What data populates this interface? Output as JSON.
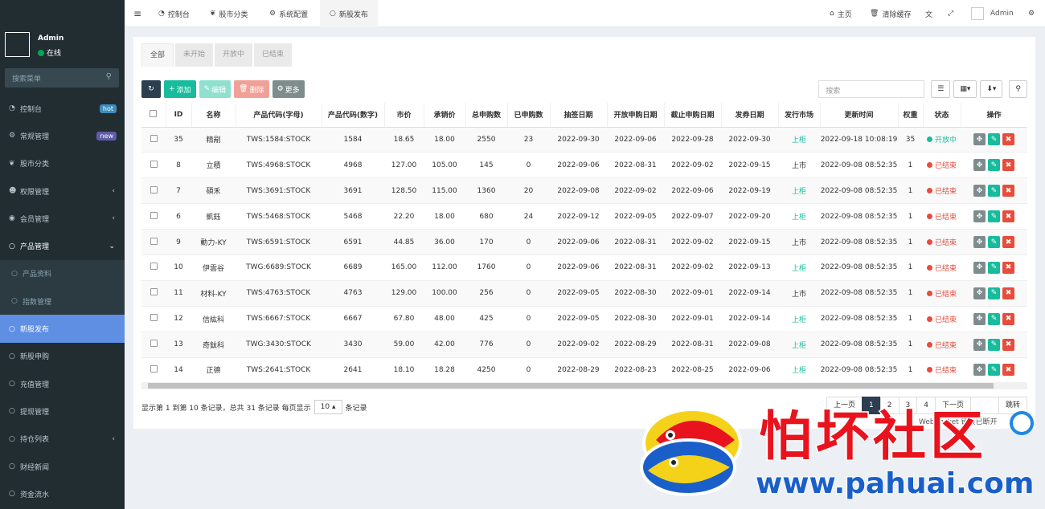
{
  "user": {
    "name": "Admin",
    "status": "在线"
  },
  "sidebar": {
    "search_placeholder": "搜索菜单",
    "items": [
      {
        "label": "控制台",
        "badge": "hot",
        "icon": "dashboard-icon"
      },
      {
        "label": "常规管理",
        "badge": "new",
        "icon": "cogs-icon"
      },
      {
        "label": "股市分类",
        "icon": "leaf-icon"
      },
      {
        "label": "权限管理",
        "icon": "group-icon",
        "caret": "‹"
      },
      {
        "label": "会员管理",
        "icon": "user-circle-icon",
        "caret": "‹"
      },
      {
        "label": "产品管理",
        "icon": "circle-icon",
        "caret": "⌄"
      },
      {
        "label": "产品资料",
        "icon": "circle-icon",
        "sub": true
      },
      {
        "label": "指数管理",
        "icon": "circle-icon",
        "sub": true
      },
      {
        "label": "新股发布",
        "icon": "circle-icon",
        "active": true
      },
      {
        "label": "新股申购",
        "icon": "circle-icon"
      },
      {
        "label": "充值管理",
        "icon": "circle-icon"
      },
      {
        "label": "提现管理",
        "icon": "circle-icon"
      },
      {
        "label": "持仓列表",
        "icon": "circle-icon",
        "caret": "‹"
      },
      {
        "label": "财经新闻",
        "icon": "circle-icon"
      },
      {
        "label": "资金流水",
        "icon": "circle-icon"
      }
    ]
  },
  "topbar": {
    "tabs": [
      "控制台",
      "股市分类",
      "系统配置",
      "新股发布"
    ],
    "home": "主页",
    "clear_cache": "清除缓存",
    "admin": "Admin"
  },
  "content": {
    "tabs": [
      "全部",
      "未开始",
      "开放中",
      "已结束"
    ],
    "buttons": {
      "add": "添加",
      "edit": "编辑",
      "delete": "删除",
      "more": "更多"
    },
    "search_placeholder": "搜索",
    "columns": [
      "ID",
      "名称",
      "产品代码(字母)",
      "产品代码(数字)",
      "市价",
      "承销价",
      "总申购数",
      "已申购数",
      "抽签日期",
      "开放申购日期",
      "截止申购日期",
      "发券日期",
      "发行市场",
      "更新时间",
      "权重",
      "状态",
      "操作"
    ],
    "rows": [
      {
        "id": "35",
        "name": "精剐",
        "code_alpha": "TWS:1584:STOCK",
        "code_num": "1584",
        "price": "18.65",
        "underwrite": "18.00",
        "total": "2550",
        "applied": "23",
        "draw": "2022-09-30",
        "open": "2022-09-06",
        "close": "2022-09-28",
        "issue": "2022-09-30",
        "market": "上柜",
        "updated": "2022-09-18 10:08:19",
        "weight": "35",
        "status": "开放中",
        "status_color": "#18bc9c",
        "market_color": "#18bc9c"
      },
      {
        "id": "8",
        "name": "立積",
        "code_alpha": "TWS:4968:STOCK",
        "code_num": "4968",
        "price": "127.00",
        "underwrite": "105.00",
        "total": "145",
        "applied": "0",
        "draw": "2022-09-06",
        "open": "2022-08-31",
        "close": "2022-09-02",
        "issue": "2022-09-15",
        "market": "上市",
        "updated": "2022-09-08 08:52:35",
        "weight": "1",
        "status": "已结束",
        "status_color": "#e74c3c",
        "market_color": "#333333"
      },
      {
        "id": "7",
        "name": "碩禾",
        "code_alpha": "TWS:3691:STOCK",
        "code_num": "3691",
        "price": "128.50",
        "underwrite": "115.00",
        "total": "1360",
        "applied": "20",
        "draw": "2022-09-08",
        "open": "2022-09-02",
        "close": "2022-09-06",
        "issue": "2022-09-19",
        "market": "上柜",
        "updated": "2022-09-08 08:52:35",
        "weight": "1",
        "status": "已结束",
        "status_color": "#e74c3c",
        "market_color": "#18bc9c"
      },
      {
        "id": "6",
        "name": "凱鈺",
        "code_alpha": "TWS:5468:STOCK",
        "code_num": "5468",
        "price": "22.20",
        "underwrite": "18.00",
        "total": "680",
        "applied": "24",
        "draw": "2022-09-12",
        "open": "2022-09-05",
        "close": "2022-09-07",
        "issue": "2022-09-20",
        "market": "上柜",
        "updated": "2022-09-08 08:52:35",
        "weight": "1",
        "status": "已结束",
        "status_color": "#e74c3c",
        "market_color": "#18bc9c"
      },
      {
        "id": "9",
        "name": "動力-KY",
        "code_alpha": "TWS:6591:STOCK",
        "code_num": "6591",
        "price": "44.85",
        "underwrite": "36.00",
        "total": "170",
        "applied": "0",
        "draw": "2022-09-06",
        "open": "2022-08-31",
        "close": "2022-09-02",
        "issue": "2022-09-15",
        "market": "上市",
        "updated": "2022-09-08 08:52:35",
        "weight": "1",
        "status": "已结束",
        "status_color": "#e74c3c",
        "market_color": "#333333"
      },
      {
        "id": "10",
        "name": "伊雲谷",
        "code_alpha": "TWG:6689:STOCK",
        "code_num": "6689",
        "price": "165.00",
        "underwrite": "112.00",
        "total": "1760",
        "applied": "0",
        "draw": "2022-09-06",
        "open": "2022-08-31",
        "close": "2022-09-02",
        "issue": "2022-09-13",
        "market": "上柜",
        "updated": "2022-09-08 08:52:35",
        "weight": "1",
        "status": "已结束",
        "status_color": "#e74c3c",
        "market_color": "#18bc9c"
      },
      {
        "id": "11",
        "name": "材料-KY",
        "code_alpha": "TWS:4763:STOCK",
        "code_num": "4763",
        "price": "129.00",
        "underwrite": "100.00",
        "total": "256",
        "applied": "0",
        "draw": "2022-09-05",
        "open": "2022-08-30",
        "close": "2022-09-01",
        "issue": "2022-09-14",
        "market": "上市",
        "updated": "2022-09-08 08:52:35",
        "weight": "1",
        "status": "已结束",
        "status_color": "#e74c3c",
        "market_color": "#333333"
      },
      {
        "id": "12",
        "name": "信紘科",
        "code_alpha": "TWS:6667:STOCK",
        "code_num": "6667",
        "price": "67.80",
        "underwrite": "48.00",
        "total": "425",
        "applied": "0",
        "draw": "2022-09-05",
        "open": "2022-08-30",
        "close": "2022-09-01",
        "issue": "2022-09-14",
        "market": "上柜",
        "updated": "2022-09-08 08:52:35",
        "weight": "1",
        "status": "已结束",
        "status_color": "#e74c3c",
        "market_color": "#18bc9c"
      },
      {
        "id": "13",
        "name": "奇鈦科",
        "code_alpha": "TWG:3430:STOCK",
        "code_num": "3430",
        "price": "59.00",
        "underwrite": "42.00",
        "total": "776",
        "applied": "0",
        "draw": "2022-09-02",
        "open": "2022-08-29",
        "close": "2022-08-31",
        "issue": "2022-09-08",
        "market": "上柜",
        "updated": "2022-09-08 08:52:35",
        "weight": "1",
        "status": "已结束",
        "status_color": "#e74c3c",
        "market_color": "#18bc9c"
      },
      {
        "id": "14",
        "name": "正德",
        "code_alpha": "TWS:2641:STOCK",
        "code_num": "2641",
        "price": "18.10",
        "underwrite": "18.28",
        "total": "4250",
        "applied": "0",
        "draw": "2022-08-29",
        "open": "2022-08-23",
        "close": "2022-08-25",
        "issue": "2022-09-06",
        "market": "上柜",
        "updated": "2022-09-08 08:52:35",
        "weight": "1",
        "status": "已结束",
        "status_color": "#e74c3c",
        "market_color": "#18bc9c"
      }
    ],
    "footer": {
      "info": "显示第 1 到第 10 条记录，总共 31 条记录 每页显示",
      "page_size": "10 ▴",
      "suffix": "条记录"
    },
    "pager": [
      "上一页",
      "1",
      "2",
      "3",
      "4",
      "下一页"
    ],
    "pager_go": "跳转",
    "websocket": "WebSocket 链接已断开"
  },
  "watermark": {
    "text": "怕坏社区",
    "url": "www.pahuai.com"
  }
}
